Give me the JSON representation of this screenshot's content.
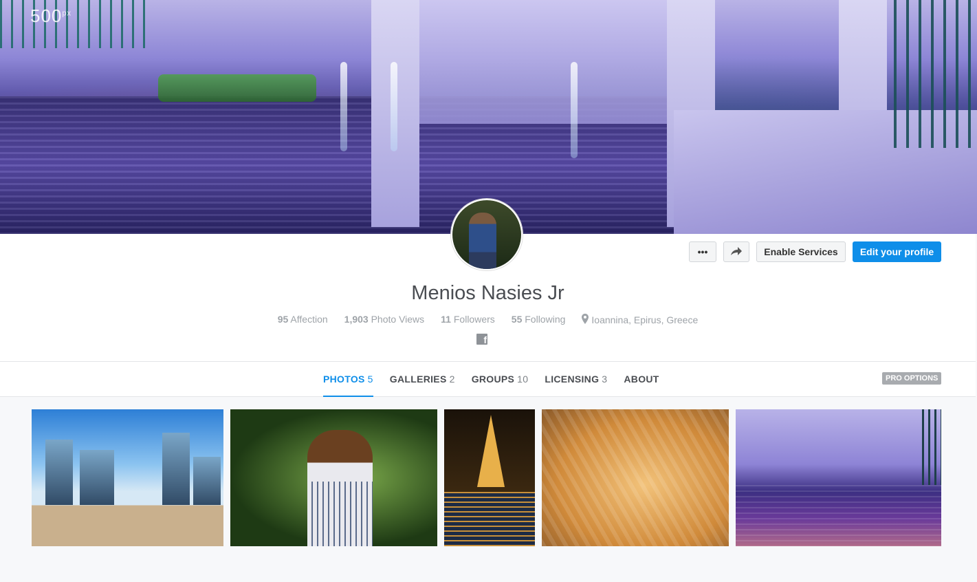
{
  "brand": {
    "logo": "500",
    "logo_sup": "px"
  },
  "profile": {
    "name": "Menios Nasies Jr",
    "stats": {
      "affection_count": "95",
      "affection_label": "Affection",
      "views_count": "1,903",
      "views_label": "Photo Views",
      "followers_count": "11",
      "followers_label": "Followers",
      "following_count": "55",
      "following_label": "Following",
      "location": "Ioannina, Epirus, Greece"
    }
  },
  "actions": {
    "more_label": "•••",
    "share_label": "➦",
    "enable_label": "Enable Services",
    "edit_label": "Edit your profile"
  },
  "tabs": [
    {
      "label": "PHOTOS",
      "count": "5"
    },
    {
      "label": "GALLERIES",
      "count": "2"
    },
    {
      "label": "GROUPS",
      "count": "10"
    },
    {
      "label": "LICENSING",
      "count": "3"
    },
    {
      "label": "ABOUT",
      "count": ""
    }
  ],
  "pro_options": "PRO OPTIONS",
  "colors": {
    "accent": "#0e8ee9",
    "muted": "#9ea3a8"
  },
  "photos": [
    {
      "subject": "business-district"
    },
    {
      "subject": "woman-forest-portrait"
    },
    {
      "subject": "eiffel-tower-night"
    },
    {
      "subject": "ginger-cat"
    },
    {
      "subject": "fountain-reflection"
    }
  ]
}
